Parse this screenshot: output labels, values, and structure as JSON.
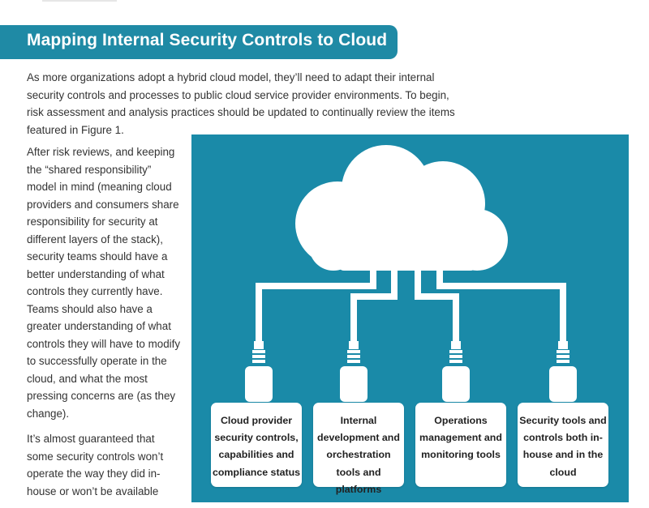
{
  "heading": "Mapping Internal Security Controls to Cloud",
  "intro": "As more organizations adopt a hybrid cloud model, they’ll need to adapt their internal security controls and processes to public cloud service provider environments. To begin, risk assessment and analysis practices should be updated to continually review the items featured in Figure 1.",
  "column_paragraphs": [
    "After risk reviews, and keeping the “shared responsibility” model in mind (meaning cloud providers and consumers share responsibility for security at different layers of the stack), security teams should have a better understanding of what controls they currently have. Teams should also have a greater understanding of what controls they will have to modify to successfully operate in the cloud, and what the most pressing concerns are (as they change).",
    "It’s almost guaranteed that some security controls won’t operate the way they did in-house or won’t be available"
  ],
  "figure": {
    "background": "#1a8aa8",
    "icon": "cloud-icon",
    "boxes": [
      "Cloud provider security controls, capabilities and compliance status",
      "Internal development and orchestration tools and platforms",
      "Operations management and monitoring tools",
      "Security tools and controls both in-house and in the cloud"
    ]
  },
  "colors": {
    "heading_bar": "#1f8aa5",
    "text": "#333333"
  }
}
